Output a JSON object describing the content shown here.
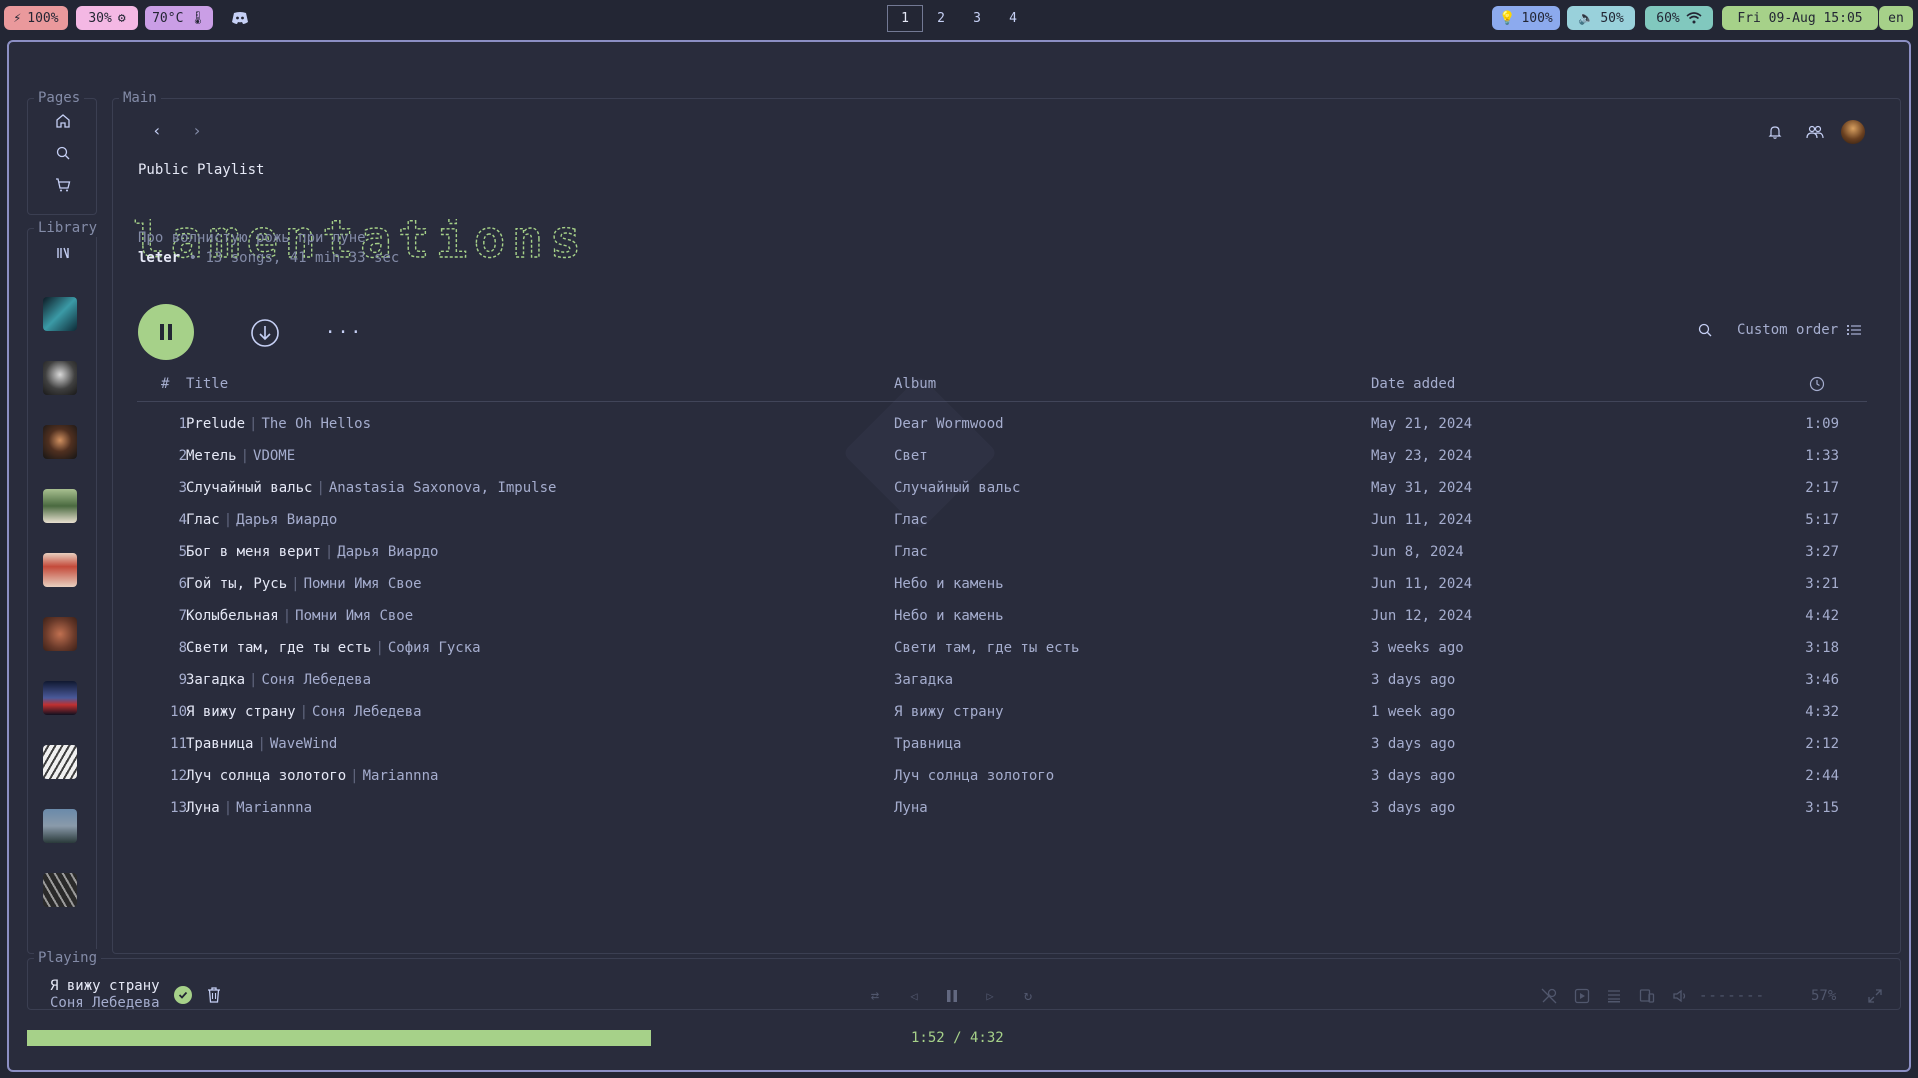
{
  "topbar": {
    "battery": "100%",
    "cpu": "30%",
    "temp": "70°C",
    "workspaces": [
      "1",
      "2",
      "3",
      "4"
    ],
    "active_workspace": 0,
    "brightness": "100%",
    "volume": "50%",
    "wifi": "60%",
    "clock": "Fri 09-Aug 15:05",
    "lang": "en",
    "colors": {
      "battery": "#ea999c",
      "cpu": "#f4b8e4",
      "temp": "#ca9ee6",
      "brightness": "#8caaee",
      "volume": "#99d1db",
      "wifi": "#81c8be",
      "clock": "#a6d189",
      "lang": "#a6d189"
    }
  },
  "sidebar": {
    "pages_label": "Pages",
    "library_label": "Library",
    "nav_icons": [
      "home-icon",
      "search-icon",
      "cart-icon",
      "library-icon"
    ],
    "covers": [
      "#3b7c86",
      "#6a6a6a",
      "#5a3a2a",
      "#6e8a5a",
      "#c44a3a",
      "#8a5a3a",
      "#2a3a6a",
      "#d0d0d0",
      "#5a6a7a",
      "#4a4a4a"
    ]
  },
  "main": {
    "label": "Main",
    "playlist_type": "Public Playlist",
    "ascii_title": "lamentations",
    "description": "Про волнистую рожь при луне",
    "owner": "leter",
    "meta": "13 songs, 41 min 33 sec",
    "sort_label": "Custom order",
    "accent": "#a6d189",
    "columns": {
      "num": "#",
      "title": "Title",
      "album": "Album",
      "date": "Date added"
    },
    "tracks": [
      {
        "n": "1",
        "title": "Prelude",
        "artist": "The Oh Hellos",
        "album": "Dear Wormwood",
        "date": "May 21, 2024",
        "dur": "1:09"
      },
      {
        "n": "2",
        "title": "Метель",
        "artist": "VDOME",
        "album": "Свет",
        "date": "May 23, 2024",
        "dur": "1:33"
      },
      {
        "n": "3",
        "title": "Случайный вальс",
        "artist": "Anastasia Saxonova, Impulse",
        "album": "Случайный вальс",
        "date": "May 31, 2024",
        "dur": "2:17"
      },
      {
        "n": "4",
        "title": "Глас",
        "artist": "Дарья Виардо",
        "album": "Глас",
        "date": "Jun 11, 2024",
        "dur": "5:17"
      },
      {
        "n": "5",
        "title": "Бог в меня верит",
        "artist": "Дарья Виардо",
        "album": "Глас",
        "date": "Jun 8, 2024",
        "dur": "3:27"
      },
      {
        "n": "6",
        "title": "Гой ты, Русь",
        "artist": "Помни Имя Свое",
        "album": "Небо и камень",
        "date": "Jun 11, 2024",
        "dur": "3:21"
      },
      {
        "n": "7",
        "title": "Колыбельная",
        "artist": "Помни Имя Свое",
        "album": "Небо и камень",
        "date": "Jun 12, 2024",
        "dur": "4:42"
      },
      {
        "n": "8",
        "title": "Свети там, где ты есть",
        "artist": "София Гуска",
        "album": "Свети там, где ты есть",
        "date": "3 weeks ago",
        "dur": "3:18"
      },
      {
        "n": "9",
        "title": "Загадка",
        "artist": "Соня Лебедева",
        "album": "Загадка",
        "date": "3 days ago",
        "dur": "3:46"
      },
      {
        "n": "10",
        "title": "Я вижу страну",
        "artist": "Соня Лебедева",
        "album": "Я вижу страну",
        "date": "1 week ago",
        "dur": "4:32"
      },
      {
        "n": "11",
        "title": "Травница",
        "artist": "WaveWind",
        "album": "Травница",
        "date": "3 days ago",
        "dur": "2:12"
      },
      {
        "n": "12",
        "title": "Луч солнца золотого",
        "artist": "Mariannna",
        "album": "Луч солнца золотого",
        "date": "3 days ago",
        "dur": "2:44"
      },
      {
        "n": "13",
        "title": "Луна",
        "artist": "Mariannna",
        "album": "Луна",
        "date": "3 days ago",
        "dur": "3:15"
      }
    ]
  },
  "player": {
    "label": "Playing",
    "track": "Я вижу страну",
    "artist": "Соня Лебедева",
    "volume": "57%",
    "volume_bar": "-------",
    "time": "1:52 / 4:32",
    "progress": 0.4118
  }
}
